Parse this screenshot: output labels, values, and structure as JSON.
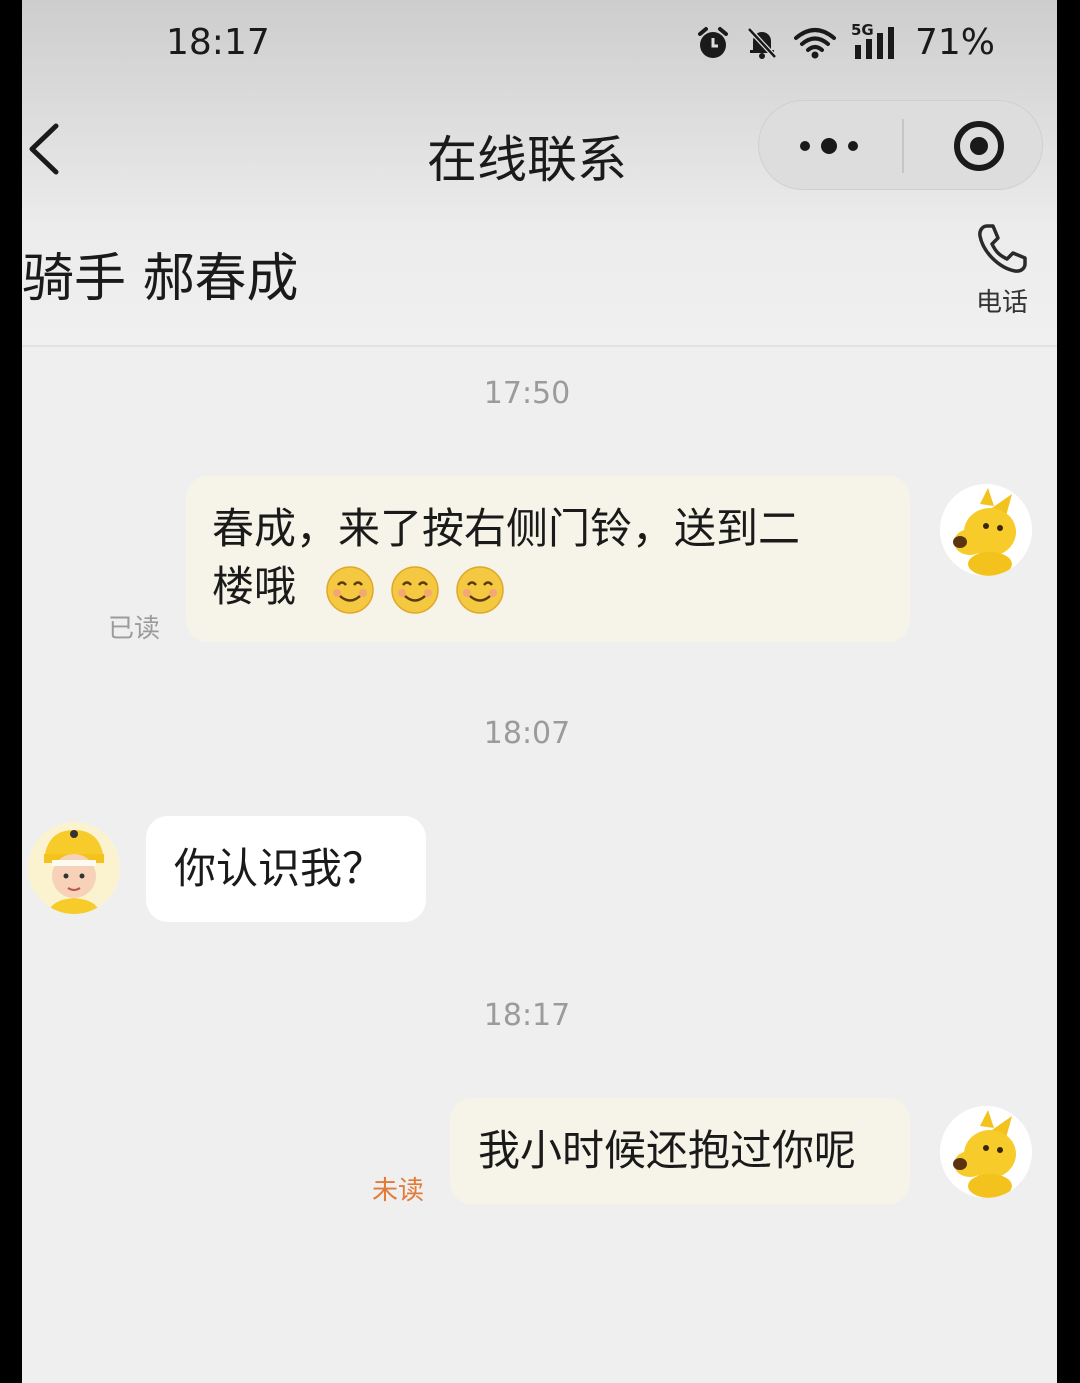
{
  "status_bar": {
    "time": "18:17",
    "network": "5G",
    "battery": "71%"
  },
  "nav": {
    "title": "在线联系"
  },
  "header": {
    "rider_name": "骑手 郝春成",
    "phone_label": "电话"
  },
  "messages": [
    {
      "time": "17:50",
      "direction": "outgoing",
      "text": "春成，来了按右侧门铃，送到二",
      "text_line2": "楼哦",
      "emoji": "☺☺☺",
      "read_status": "已读"
    },
    {
      "time": "18:07",
      "direction": "incoming",
      "text": "你认识我？"
    },
    {
      "time": "18:17",
      "direction": "outgoing",
      "text": "我小时候还抱过你呢",
      "read_status": "未读"
    }
  ],
  "colors": {
    "outgoing_bubble": "#f6f4e8",
    "incoming_bubble": "#ffffff",
    "unread": "#e07b39",
    "read": "#9b9b9b"
  },
  "icons": [
    "back-arrow-icon",
    "more-dots-icon",
    "target-icon",
    "phone-icon",
    "alarm-icon",
    "mute-bell-icon",
    "wifi-icon",
    "signal-icon"
  ]
}
